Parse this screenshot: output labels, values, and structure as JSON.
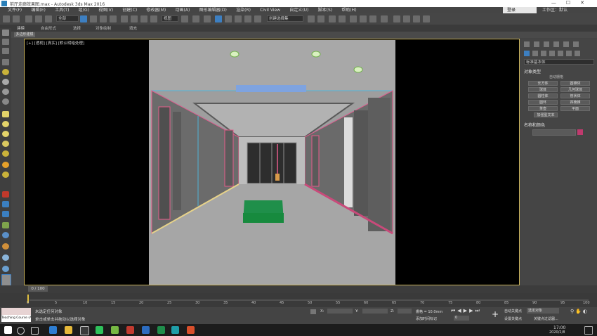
{
  "window": {
    "title": "前厅走廊效果图.max - Autodesk 3ds Max 2016",
    "signin_label": "登录",
    "workspace_label": "工作区：默认"
  },
  "menubar": {
    "items": [
      "文件(F)",
      "编辑(E)",
      "工具(T)",
      "组(G)",
      "视图(V)",
      "创建(C)",
      "修改器(M)",
      "动画(A)",
      "图形编辑器(D)",
      "渲染(R)",
      "Civil View",
      "自定义(U)",
      "脚本(S)",
      "帮助(H)"
    ]
  },
  "toolbar": {
    "selection_filter": "全部",
    "view_dropdown": "视图",
    "named_selection": "创建选择集"
  },
  "ribbon": {
    "tabs": [
      "建模",
      "自由形式",
      "选择",
      "对象绘制",
      "填充"
    ],
    "active_chip": "多边形建模"
  },
  "viewport": {
    "label": "[+] [透视] [真实] [默认明暗处理]"
  },
  "command_panel": {
    "category_dropdown": "标准基本体",
    "rollout_object_type": "对象类型",
    "autogrid_label": "自动栅格",
    "buttons": [
      "长方体",
      "圆锥体",
      "球体",
      "几何球体",
      "圆柱体",
      "管状体",
      "圆环",
      "四棱锥",
      "茶壶",
      "平面",
      "加强型文本"
    ],
    "rollout_name_color": "名称和颜色",
    "color_swatch": "#c03a6e"
  },
  "timeslider": {
    "thumb_label": "0 / 100"
  },
  "trackbar": {
    "ticks": [
      "0",
      "5",
      "10",
      "15",
      "20",
      "25",
      "30",
      "35",
      "40",
      "45",
      "50",
      "55",
      "60",
      "65",
      "70",
      "75",
      "80",
      "85",
      "90",
      "95",
      "100"
    ]
  },
  "statusbar": {
    "maxscript_hint": "MAXScript 迷你侦听器",
    "status_line1": "未选定任何对象",
    "status_line2": "单击或单击并拖动以选择对象",
    "x_label": "X:",
    "y_label": "Y:",
    "z_label": "Z:",
    "grid_label": "栅格 = 10.0mm",
    "add_time_tag": "添加时间标记",
    "auto_key": "自动关键点",
    "set_key": "设置关键点",
    "selected_label": "选定对象",
    "key_filters": "关键点过滤器...",
    "frame_value": "0"
  },
  "taskbar": {
    "time": "17:00",
    "date": "2020/2/8",
    "app_thumb": "Teaching Course (A)"
  }
}
